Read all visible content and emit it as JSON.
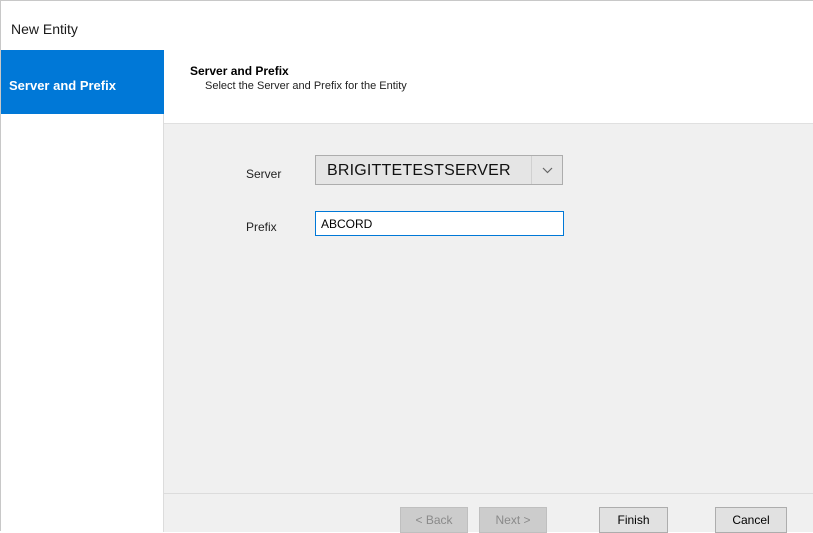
{
  "window": {
    "title": "New Entity"
  },
  "sidebar": {
    "items": [
      {
        "label": "Server and Prefix",
        "active": true
      }
    ]
  },
  "header": {
    "title": "Server and Prefix",
    "subtitle": "Select the Server and Prefix for the Entity"
  },
  "form": {
    "server": {
      "label": "Server",
      "value": "BRIGITTETESTSERVER",
      "dropdown_icon": "chevron-down-icon"
    },
    "prefix": {
      "label": "Prefix",
      "value": "ABCORD"
    }
  },
  "buttons": {
    "back_label": "< Back",
    "back_enabled": false,
    "next_label": "Next >",
    "next_enabled": false,
    "finish_label": "Finish",
    "cancel_label": "Cancel"
  },
  "colors": {
    "accent": "#0078d7",
    "content_background": "#f0f0f0",
    "disabled_button": "#cccccc"
  }
}
